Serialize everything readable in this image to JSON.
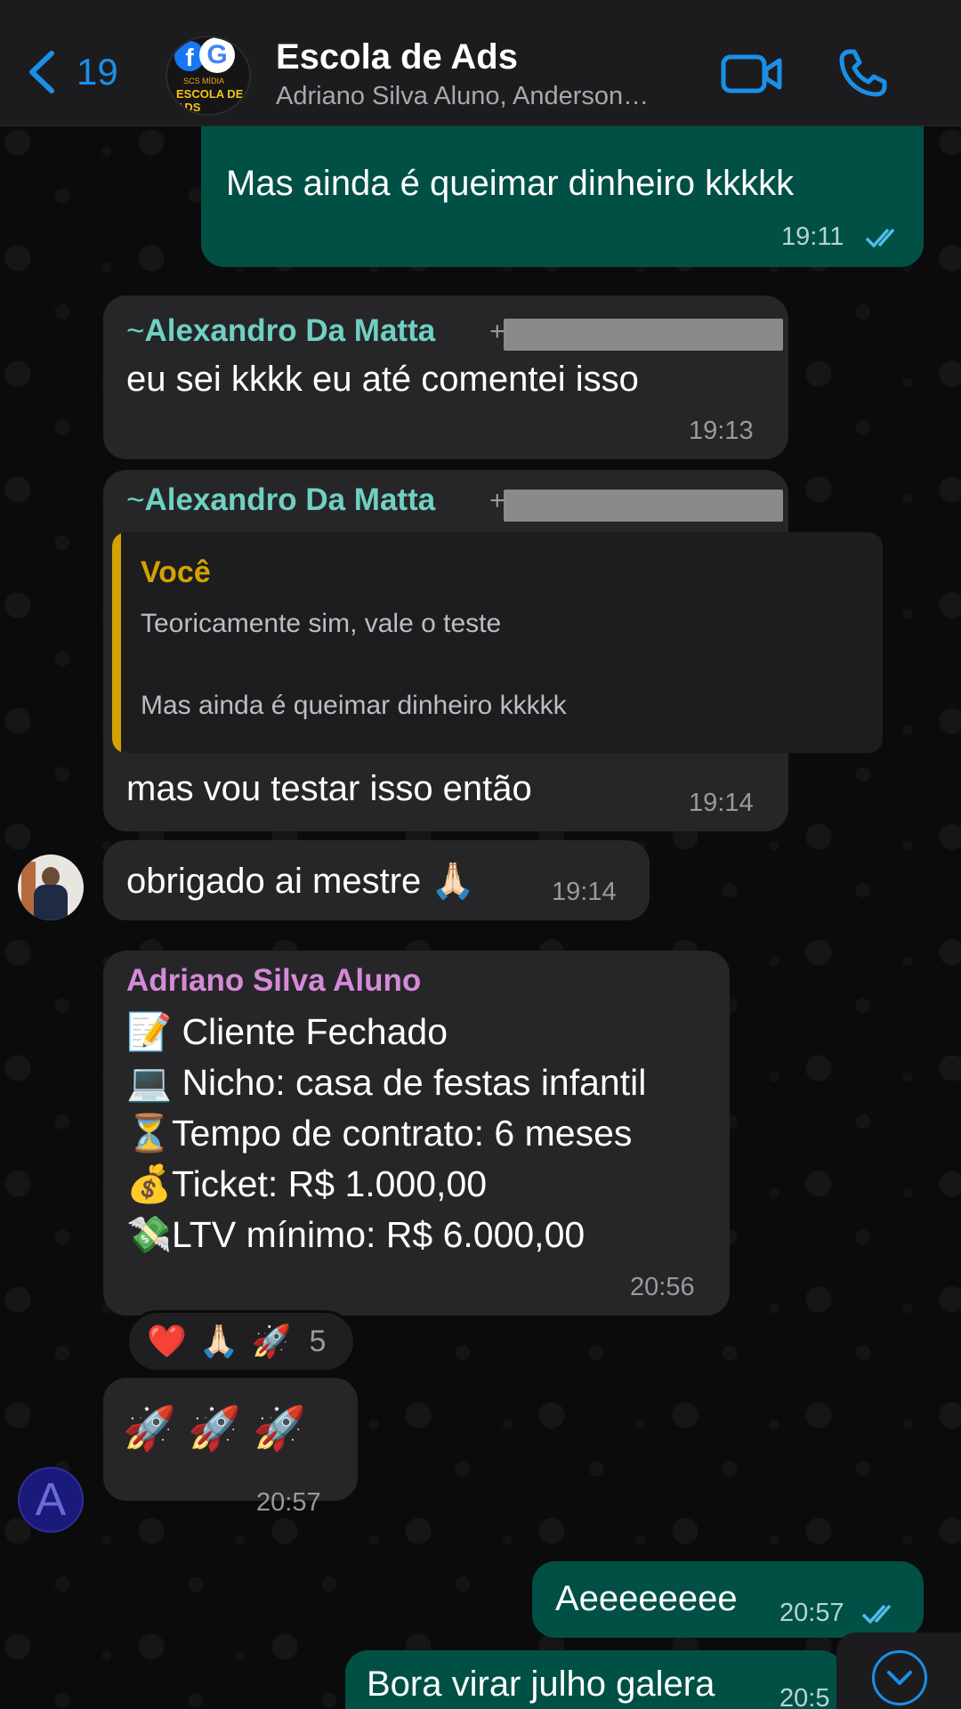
{
  "header": {
    "back_count": "19",
    "title": "Escola de Ads",
    "members": "Adriano Silva Aluno, Anderson…",
    "avatar_text_top": "SCS MÍDIA",
    "avatar_text_main": "ESCOLA DE ADS"
  },
  "messages": [
    {
      "type": "outgoing",
      "text": "Mas ainda é queimar dinheiro kkkkk",
      "time": "19:11",
      "status": "read"
    },
    {
      "type": "incoming",
      "sender_prefix": "~",
      "sender": "Alexandro Da Matta",
      "sender_plus": "+",
      "text": "eu sei kkkk eu até comentei isso",
      "time": "19:13"
    },
    {
      "type": "incoming",
      "sender_prefix": "~",
      "sender": "Alexandro Da Matta",
      "sender_plus": "+",
      "quote": {
        "author": "Você",
        "line1": "Teoricamente sim, vale o teste",
        "line2": "Mas ainda é queimar dinheiro kkkkk"
      },
      "text": "mas vou testar isso então",
      "time": "19:14"
    },
    {
      "type": "incoming",
      "text": "obrigado ai mestre 🙏🏻",
      "time": "19:14"
    },
    {
      "type": "incoming",
      "sender": "Adriano Silva Aluno",
      "lines": [
        "📝 Cliente Fechado",
        "💻 Nicho: casa de festas infantil",
        "⏳Tempo de contrato: 6 meses",
        "💰Ticket: R$ 1.000,00",
        "💸LTV mínimo: R$ 6.000,00"
      ],
      "time": "20:56",
      "reactions": {
        "emojis": [
          "❤️",
          "🙏🏻",
          "🚀"
        ],
        "count": "5"
      }
    },
    {
      "type": "incoming",
      "text": "🚀 🚀 🚀",
      "time": "20:57"
    },
    {
      "type": "outgoing",
      "text": "Aeeeeeeee",
      "time": "20:57",
      "status": "read"
    },
    {
      "type": "outgoing",
      "text": "Bora virar julho galera",
      "time": "20:5"
    }
  ],
  "colors": {
    "accent_blue": "#1a90e8",
    "outgoing_bubble": "#005046",
    "incoming_bubble": "#262628",
    "sender_alexandro": "#6fd0c3",
    "sender_adriano": "#d58ad9",
    "quote_author": "#d4a200"
  },
  "icons": [
    "chevron-left-icon",
    "video-call-icon",
    "phone-icon",
    "double-check-icon",
    "chevron-down-icon"
  ]
}
